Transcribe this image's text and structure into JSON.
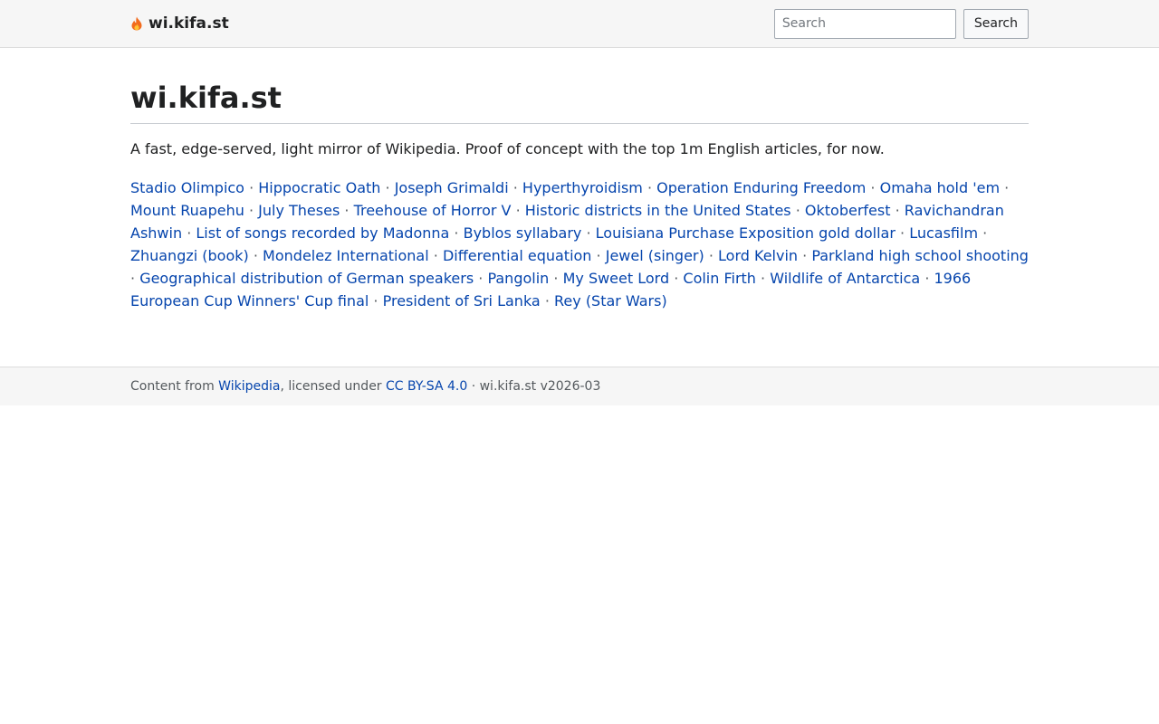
{
  "header": {
    "brand_name": "wi.kifa.st",
    "brand_icon": "flame-icon",
    "search_placeholder": "Search",
    "search_button_label": "Search"
  },
  "main": {
    "title": "wi.kifa.st",
    "tagline": "A fast, edge-served, light mirror of Wikipedia. Proof of concept with the top 1m English articles, for now.",
    "separator": "·",
    "articles": [
      "Stadio Olimpico",
      "Hippocratic Oath",
      "Joseph Grimaldi",
      "Hyperthyroidism",
      "Operation Enduring Freedom",
      "Omaha hold 'em",
      "Mount Ruapehu",
      "July Theses",
      "Treehouse of Horror V",
      "Historic districts in the United States",
      "Oktoberfest",
      "Ravichandran Ashwin",
      "List of songs recorded by Madonna",
      "Byblos syllabary",
      "Louisiana Purchase Exposition gold dollar",
      "Lucasfilm",
      "Zhuangzi (book)",
      "Mondelez International",
      "Differential equation",
      "Jewel (singer)",
      "Lord Kelvin",
      "Parkland high school shooting",
      "Geographical distribution of German speakers",
      "Pangolin",
      "My Sweet Lord",
      "Colin Firth",
      "Wildlife of Antarctica",
      "1966 European Cup Winners' Cup final",
      "President of Sri Lanka",
      "Rey (Star Wars)"
    ]
  },
  "footer": {
    "prefix": "Content from ",
    "source_link": "Wikipedia",
    "middle": ", licensed under ",
    "license_link": "CC BY-SA 4.0",
    "suffix": " · wi.kifa.st v2026-03"
  },
  "colors": {
    "link": "#0645ad",
    "text": "#202122",
    "bar_background": "#f6f6f6",
    "flame_outer": "#f26b1d",
    "flame_inner": "#ffc233"
  }
}
